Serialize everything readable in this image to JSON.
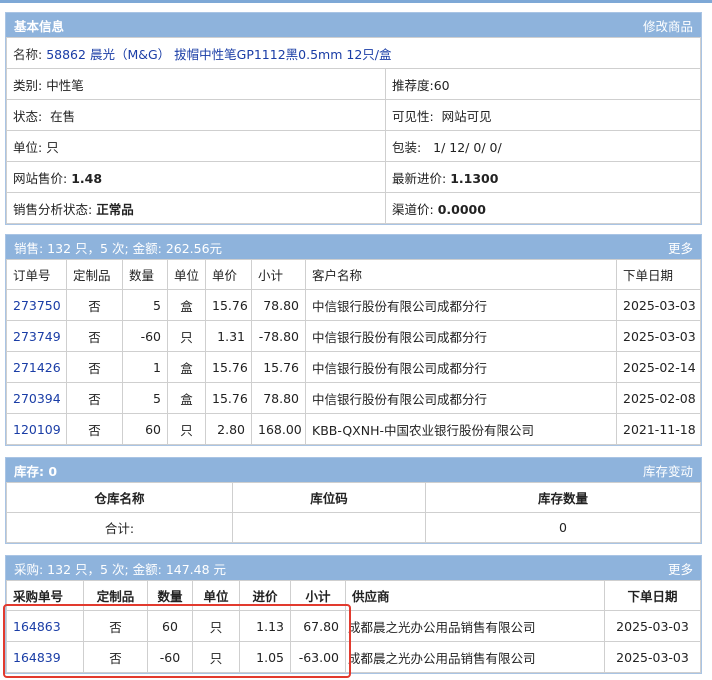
{
  "basic": {
    "title": "基本信息",
    "edit_link": "修改商品",
    "name_label": "名称:",
    "product_name": "58862 晨光（M&G） 拔帽中性笔GP1112黑0.5mm 12只/盒",
    "rows": [
      {
        "left_label": "类别:",
        "left_value": "中性笔",
        "right_label": "推荐度:",
        "right_value": "60"
      },
      {
        "left_label": "状态:",
        "left_value": "在售",
        "right_label": "可见性:",
        "right_value": "网站可见"
      },
      {
        "left_label": "单位:",
        "left_value": "只",
        "right_label": "包装:",
        "right_value": "1/ 12/ 0/ 0/"
      },
      {
        "left_label": "网站售价:",
        "left_value": "1.48",
        "right_label": "最新进价:",
        "right_value": "1.1300"
      },
      {
        "left_label": "销售分析状态:",
        "left_value": "正常品",
        "right_label": "渠道价:",
        "right_value": "0.0000"
      }
    ]
  },
  "sales": {
    "title": "销售:  132 只，5 次; 金额: 262.56元",
    "more_link": "更多",
    "headers": [
      "订单号",
      "定制品",
      "数量",
      "单位",
      "单价",
      "小计",
      "客户名称",
      "下单日期"
    ],
    "rows": [
      [
        "273750",
        "否",
        "5",
        "盒",
        "15.76",
        "78.80",
        "中信银行股份有限公司成都分行",
        "2025-03-03"
      ],
      [
        "273749",
        "否",
        "-60",
        "只",
        "1.31",
        "-78.80",
        "中信银行股份有限公司成都分行",
        "2025-03-03"
      ],
      [
        "271426",
        "否",
        "1",
        "盒",
        "15.76",
        "15.76",
        "中信银行股份有限公司成都分行",
        "2025-02-14"
      ],
      [
        "270394",
        "否",
        "5",
        "盒",
        "15.76",
        "78.80",
        "中信银行股份有限公司成都分行",
        "2025-02-08"
      ],
      [
        "120109",
        "否",
        "60",
        "只",
        "2.80",
        "168.00",
        "KBB-QXNH-中国农业银行股份有限公司",
        "2021-11-18"
      ]
    ]
  },
  "stock": {
    "title": "库存:  0",
    "change_link": "库存变动",
    "headers": [
      "仓库名称",
      "库位码",
      "库存数量"
    ],
    "total_label": "合计:",
    "total_code": "",
    "total_qty": "0"
  },
  "purchase": {
    "title": "采购:  132 只，5 次; 金额: 147.48 元",
    "more_link": "更多",
    "headers": [
      "采购单号",
      "定制品",
      "数量",
      "单位",
      "进价",
      "小计",
      "供应商",
      "下单日期"
    ],
    "rows": [
      [
        "164863",
        "否",
        "60",
        "只",
        "1.13",
        "67.80",
        "成都晨之光办公用品销售有限公司",
        "2025-03-03"
      ],
      [
        "164839",
        "否",
        "-60",
        "只",
        "1.05",
        "-63.00",
        "成都晨之光办公用品销售有限公司",
        "2025-03-03"
      ]
    ]
  },
  "colors": {
    "header_bg": "#8eb3dc",
    "link": "#1a3da6",
    "highlight_border": "#e23a2e"
  }
}
